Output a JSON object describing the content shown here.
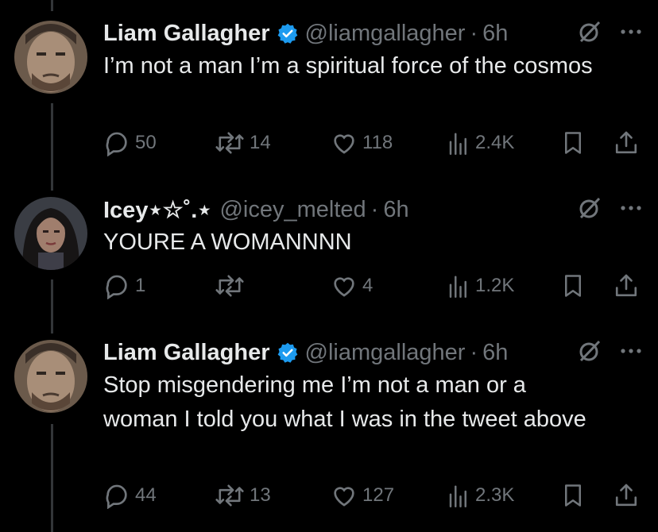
{
  "tweets": [
    {
      "name": "Liam Gallagher",
      "handle": "@liamgallagher",
      "time": "6h",
      "text": "I’m not a man I’m a spiritual force of the cosmos",
      "replies": "50",
      "retweets": "14",
      "likes": "118",
      "views": "2.4K",
      "verified": true
    },
    {
      "name": "Icey⋆☆˚.⋆",
      "handle": "@icey_melted",
      "time": "6h",
      "text": "YOURE A WOMANNNN",
      "replies": "1",
      "retweets": "",
      "likes": "4",
      "views": "1.2K",
      "verified": false
    },
    {
      "name": "Liam Gallagher",
      "handle": "@liamgallagher",
      "time": "6h",
      "text": "Stop misgendering me I’m not a man or a woman I told you what I was in the tweet above",
      "replies": "44",
      "retweets": "13",
      "likes": "127",
      "views": "2.3K",
      "verified": true
    }
  ],
  "separator": "·",
  "colors": {
    "background": "#000000",
    "text": "#e7e9ea",
    "secondary": "#71767b",
    "verified": "#1d9bf0"
  }
}
